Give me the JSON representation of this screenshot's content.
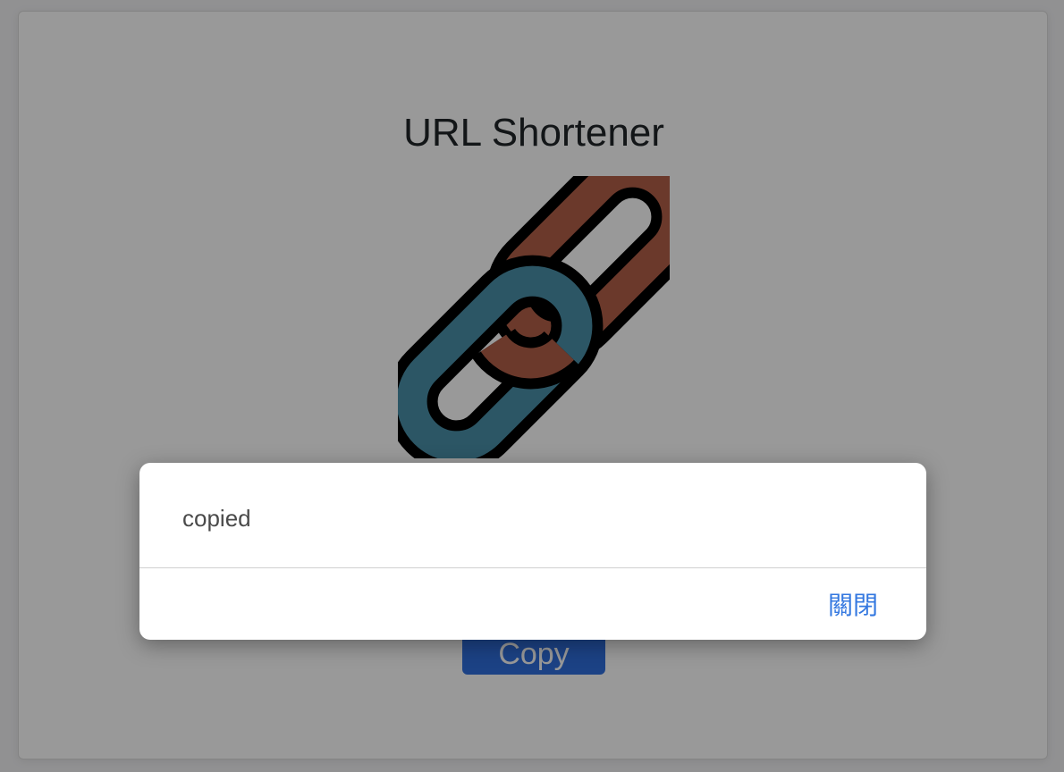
{
  "app": {
    "title": "URL Shortener",
    "logo_icon": "chain-link-icon"
  },
  "actions": {
    "copy_label": "Copy"
  },
  "dialog": {
    "message": "copied",
    "close_label": "關閉"
  },
  "colors": {
    "accent": "#2f6fde",
    "link_blue": "#3478e0",
    "chain_teal": "#4a8fa8",
    "chain_rust": "#b35f48"
  }
}
